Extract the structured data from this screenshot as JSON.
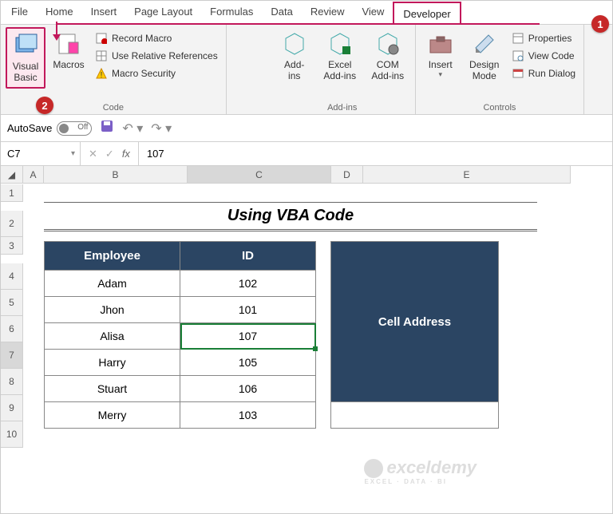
{
  "tabs": {
    "t0": "File",
    "t1": "Home",
    "t2": "Insert",
    "t3": "Page Layout",
    "t4": "Formulas",
    "t5": "Data",
    "t6": "Review",
    "t7": "View",
    "t8": "Developer"
  },
  "ribbon": {
    "code": {
      "label": "Code",
      "vb": "Visual Basic",
      "macros": "Macros",
      "record": "Record Macro",
      "relref": "Use Relative References",
      "sec": "Macro Security"
    },
    "addins": {
      "label": "Add-ins",
      "addins": "Add-\nins",
      "excel": "Excel Add-ins",
      "com": "COM Add-ins"
    },
    "controls": {
      "label": "Controls",
      "insert": "Insert",
      "design": "Design Mode",
      "props": "Properties",
      "viewcode": "View Code",
      "dialog": "Run Dialog"
    }
  },
  "qat": {
    "autosave": "AutoSave",
    "off": "Off"
  },
  "fbar": {
    "name": "C7",
    "value": "107"
  },
  "cols": {
    "a": "A",
    "b": "B",
    "c": "C",
    "d": "D",
    "e": "E"
  },
  "title": "Using VBA Code",
  "table1": {
    "h1": "Employee",
    "h2": "ID",
    "r1c1": "Adam",
    "r1c2": "102",
    "r2c1": "Jhon",
    "r2c2": "101",
    "r3c1": "Alisa",
    "r3c2": "107",
    "r4c1": "Harry",
    "r4c2": "105",
    "r5c1": "Stuart",
    "r5c2": "106",
    "r6c1": "Merry",
    "r6c2": "103"
  },
  "table2": {
    "h1": "Cell Address"
  },
  "badge": {
    "one": "1",
    "two": "2"
  },
  "watermark": {
    "brand": "exceldemy",
    "tag": "EXCEL · DATA · BI"
  },
  "chart_data": {
    "type": "table",
    "title": "Using VBA Code",
    "headers": [
      "Employee",
      "ID"
    ],
    "rows": [
      [
        "Adam",
        102
      ],
      [
        "Jhon",
        101
      ],
      [
        "Alisa",
        107
      ],
      [
        "Harry",
        105
      ],
      [
        "Stuart",
        106
      ],
      [
        "Merry",
        103
      ]
    ],
    "aux_headers": [
      "Cell Address"
    ],
    "selected_cell": "C7"
  }
}
